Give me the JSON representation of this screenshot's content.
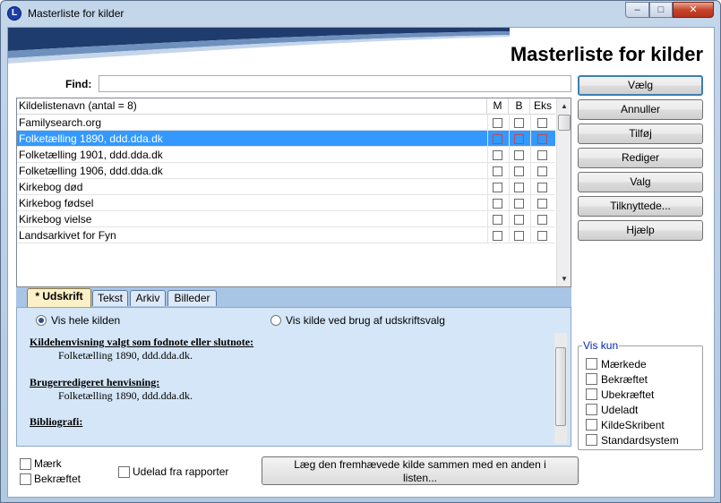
{
  "window": {
    "title": "Masterliste for kilder",
    "icon_letter": "L",
    "minimize": "–",
    "maximize": "□",
    "close": "✕"
  },
  "header": {
    "title": "Masterliste for kilder"
  },
  "find": {
    "label": "Find:",
    "value": ""
  },
  "list": {
    "columns": {
      "name": "Kildelistenavn (antal = 8)",
      "m": "M",
      "b": "B",
      "eks": "Eks"
    },
    "rows": [
      {
        "name": "Familysearch.org",
        "selected": false
      },
      {
        "name": "Folketælling 1890, ddd.dda.dk",
        "selected": true
      },
      {
        "name": "Folketælling 1901, ddd.dda.dk",
        "selected": false
      },
      {
        "name": "Folketælling 1906, ddd.dda.dk",
        "selected": false
      },
      {
        "name": "Kirkebog død",
        "selected": false
      },
      {
        "name": "Kirkebog fødsel",
        "selected": false
      },
      {
        "name": "Kirkebog vielse",
        "selected": false
      },
      {
        "name": "Landsarkivet for Fyn",
        "selected": false
      }
    ]
  },
  "tabs": [
    {
      "label": "* Udskrift",
      "active": true
    },
    {
      "label": "Tekst",
      "active": false
    },
    {
      "label": "Arkiv",
      "active": false
    },
    {
      "label": "Billeder",
      "active": false
    }
  ],
  "panel": {
    "radio_all": "Vis hele kilden",
    "radio_print": "Vis kilde ved brug af udskriftsvalg",
    "footnote_title": "Kildehenvisning valgt som fodnote eller slutnote:",
    "footnote_text": "Folketælling 1890, ddd.dda.dk.",
    "user_title": "Brugerredigeret henvisning:",
    "user_text": "Folketælling 1890, ddd.dda.dk.",
    "bib_title": "Bibliografi:"
  },
  "bottom": {
    "mark": "Mærk",
    "confirmed": "Bekræftet",
    "exclude": "Udelad fra rapporter",
    "merge_line1": "Læg den fremhævede kilde sammen med en anden i",
    "merge_line2": "listen..."
  },
  "buttons": {
    "select": "Vælg",
    "cancel": "Annuller",
    "add": "Tilføj",
    "edit": "Rediger",
    "options": "Valg",
    "linked": "Tilknyttede...",
    "help": "Hjælp"
  },
  "viskun": {
    "title": "Vis kun",
    "items": [
      "Mærkede",
      "Bekræftet",
      "Ubekræftet",
      "Udeladt",
      "KildeSkribent",
      "Standardsystem"
    ]
  },
  "colors": {
    "selection": "#3399ff",
    "title_blue": "#0026b3",
    "tab_active": "#fbf0c7",
    "panel_bg": "#d4e6f7"
  }
}
